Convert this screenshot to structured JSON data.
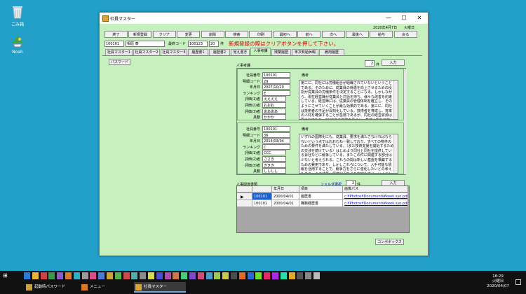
{
  "desktop": {
    "icons": [
      {
        "label": "ごみ箱"
      },
      {
        "label": "Noah"
      }
    ]
  },
  "window": {
    "title": "社員マスター",
    "controls": {
      "min": "—",
      "max": "☐",
      "close": "✕"
    }
  },
  "header": {
    "date": "2020年4月7日",
    "weekday": "火曜日"
  },
  "toolbar": [
    "終了",
    "新規登録",
    "クリア",
    "変更",
    "削除",
    "検索",
    "印刷",
    "最初へ",
    "前へ",
    "次へ",
    "最後へ",
    "給与",
    "戻る"
  ],
  "record": {
    "emp_no": "100101",
    "emp_name": "相原 泰",
    "last_code_label": "最終コード",
    "last_code": "100123",
    "count": "20",
    "count_unit": "件",
    "notice": "新規登録の際はクリアボタンを押して下さい。"
  },
  "tabs": [
    "社員マスター1",
    "社員マスター2",
    "社員マスター3",
    "履歴書1",
    "履歴書2",
    "覚え書き",
    "人事考課",
    "残業履歴",
    "年次有給休暇",
    "雇用履歴"
  ],
  "password_button": "パスワード",
  "hr_eval": {
    "title": "人事考課",
    "count": "2",
    "count_unit": "件",
    "enter_button": "入力",
    "labels": {
      "emp_no": "社員番号",
      "detail_code": "明細コード",
      "date": "年月日",
      "rank": "ランキング",
      "eval1": "評価(1)者",
      "eval2": "評価(2)者",
      "eval3": "評価(3)者",
      "concrete": "具動",
      "notes": "備考"
    },
    "records": [
      {
        "emp_no": "100101",
        "detail_code": "29",
        "date": "2007/10/20",
        "rank": "E",
        "eval1": "ええええ",
        "eval2": "おおお",
        "eval3": "ああああ",
        "concrete": "かかか",
        "notes": "第二に、同社には労働組合が組織されていないということである。そのために、従業員の待遇を向上させるための役割が従業員の労働条件を決定することになる。しかしながら、現在経営陣が従業員と対話を持ち、様々な改善を約束している。経営陣には、従業員の管理体制を確立し、そのようにさせていくことが最も効果的である。第三に、同社は技術者の不足が深刻化している。技術者を育成し、将来の人材を確保することが急務であるが、同社の経営資源は限られており、2006年の財務を見ると、株式上場を目指した活動を行っている。"
      },
      {
        "emp_no": "100101",
        "detail_code": "36",
        "date": "2014/03/04",
        "rank": "C",
        "eval1": "CCC",
        "eval2": "ささき",
        "eval3": "ききき",
        "concrete": "しししし",
        "notes": "いずれの国際化にも、従業員、要求を満たさなければならないという点ではおおむね一致しており、すべての物件のための要件を満たしている。（また技術支援を開始するための交渉を続けている）はじめより同社と同社を提供している会社などに競争している。またこの件に関連する部分は少ないと考えられる。これらの間は新しい基盤を構築するための費用であり、しかしこれらについて、入手可能な情報を活用することで、競争力をさらに強化したいとの考えもある。その結果、経営状況をより安定化させ、いくつかの課題を解決していくことが必要となるであろう。"
      }
    ]
  },
  "docs": {
    "title": "人事関連書類",
    "folder_link": "フォルダ選択",
    "count": "2",
    "count_unit": "件",
    "enter_button": "入力",
    "columns": [
      "",
      "年月日",
      "項目",
      "画像パス"
    ],
    "rows": [
      {
        "emp_no": "100101",
        "date": "2000/04/01",
        "item": "履歴書",
        "path": "c:¥Photos¥Documents¥keek.syo.pdf"
      },
      {
        "emp_no": "100101",
        "date": "2000/04/01",
        "item": "職務経歴書",
        "path": "c:¥Photos¥Documents¥keek.syo.pdf"
      }
    ]
  },
  "combo_button": "コンボボックス",
  "taskbar": {
    "apps": [
      {
        "label": "起動時パスワード"
      },
      {
        "label": "メニュー"
      },
      {
        "label": "社員マスター"
      }
    ],
    "clock": {
      "time": "18:29",
      "weekday": "火曜日",
      "date": "2020/04/07"
    }
  }
}
